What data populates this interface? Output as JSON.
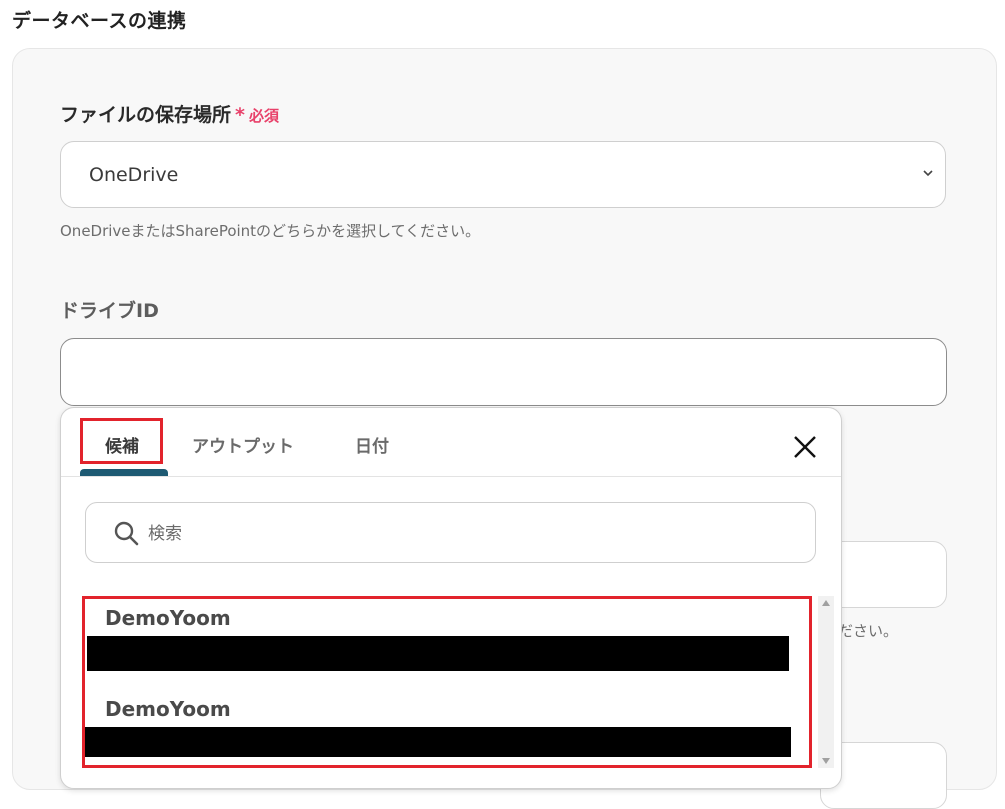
{
  "section": {
    "title": "データベースの連携"
  },
  "storage_location": {
    "label": "ファイルの保存場所",
    "required_mark": "*",
    "required_text": "必須",
    "selected_value": "OneDrive",
    "help": "OneDriveまたはSharePointのどちらかを選択してください。"
  },
  "drive_id": {
    "label": "ドライブID",
    "value": ""
  },
  "background": {
    "help_fragment": "ださい。"
  },
  "dropdown": {
    "tabs": [
      {
        "label": "候補",
        "active": true
      },
      {
        "label": "アウトプット",
        "active": false
      },
      {
        "label": "日付",
        "active": false
      }
    ],
    "close_icon": "close-icon",
    "search": {
      "placeholder": "検索",
      "value": ""
    },
    "items": [
      {
        "title": "DemoYoom",
        "subtitle_redacted": true
      },
      {
        "title": "DemoYoom",
        "subtitle_redacted": true
      }
    ]
  },
  "colors": {
    "required": "#e8416a",
    "highlight": "#e2232c",
    "tab_accent": "#1e5a73"
  }
}
